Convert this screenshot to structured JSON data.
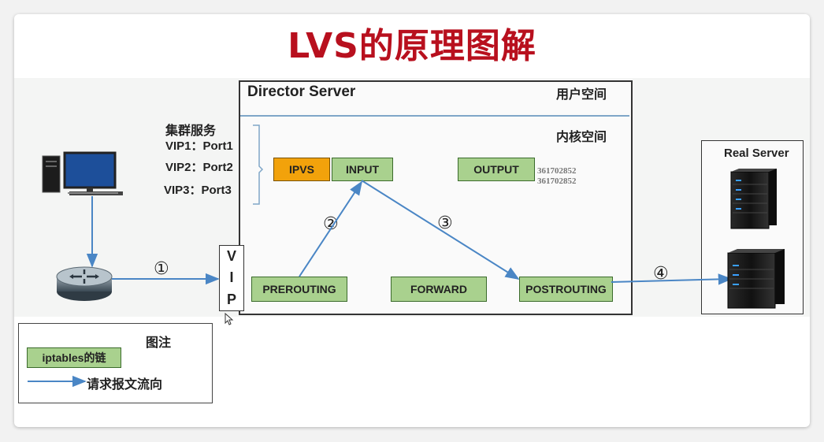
{
  "title": "LVS的原理图解",
  "director": {
    "label": "Director Server",
    "user_space": "用户空间",
    "kernel_space": "内核空间"
  },
  "cluster": {
    "heading": "集群服务",
    "services": [
      "VIP1：Port1",
      "VIP2：Port2",
      "VIP3：Port3"
    ]
  },
  "chains": {
    "ipvs": "IPVS",
    "input": "INPUT",
    "output": "OUTPUT",
    "prerouting": "PREROUTING",
    "forward": "FORWARD",
    "postrouting": "POSTROUTING"
  },
  "vip_letters": [
    "V",
    "I",
    "P"
  ],
  "steps": [
    "①",
    "②",
    "③",
    "④"
  ],
  "watermark": [
    "361702852",
    "361702852"
  ],
  "real_server": {
    "label": "Real Server"
  },
  "legend": {
    "title": "图注",
    "chain_label": "iptables的链",
    "arrow_label": "请求报文流向"
  },
  "colors": {
    "title": "#b8101e",
    "chain_fill": "#a9d18e",
    "ipvs_fill": "#f2a20b",
    "arrow": "#4a86c5"
  }
}
